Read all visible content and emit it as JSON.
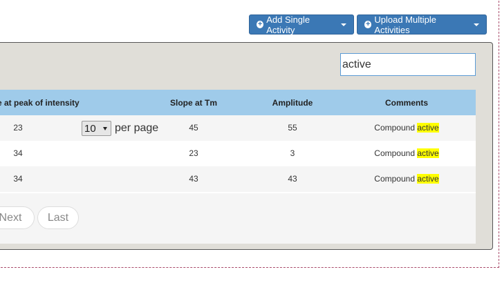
{
  "toolbar": {
    "add_single_label": "Add Single Activity",
    "upload_multiple_label": "Upload Multiple Activities"
  },
  "search": {
    "value": "active"
  },
  "table": {
    "headers": [
      "e at peak of intensity",
      "Slope at Tm",
      "Amplitude",
      "Comments"
    ],
    "rows": [
      {
        "c1": "23",
        "c2": "45",
        "c3": "55",
        "comment_prefix": "Compound",
        "comment_match": "active"
      },
      {
        "c1": "34",
        "c2": "23",
        "c3": "3",
        "comment_prefix": "Compound",
        "comment_match": "active"
      },
      {
        "c1": "34",
        "c2": "43",
        "c3": "43",
        "comment_prefix": "Compound",
        "comment_match": "active"
      }
    ]
  },
  "pagination": {
    "next_label": "Next",
    "last_label": "Last",
    "per_page_value": "10",
    "per_page_label": "per page"
  },
  "colors": {
    "button_bg": "#3b78b5",
    "header_bg": "#9fcbea",
    "highlight": "#ffff00",
    "panel_bg": "#e0ded8"
  }
}
